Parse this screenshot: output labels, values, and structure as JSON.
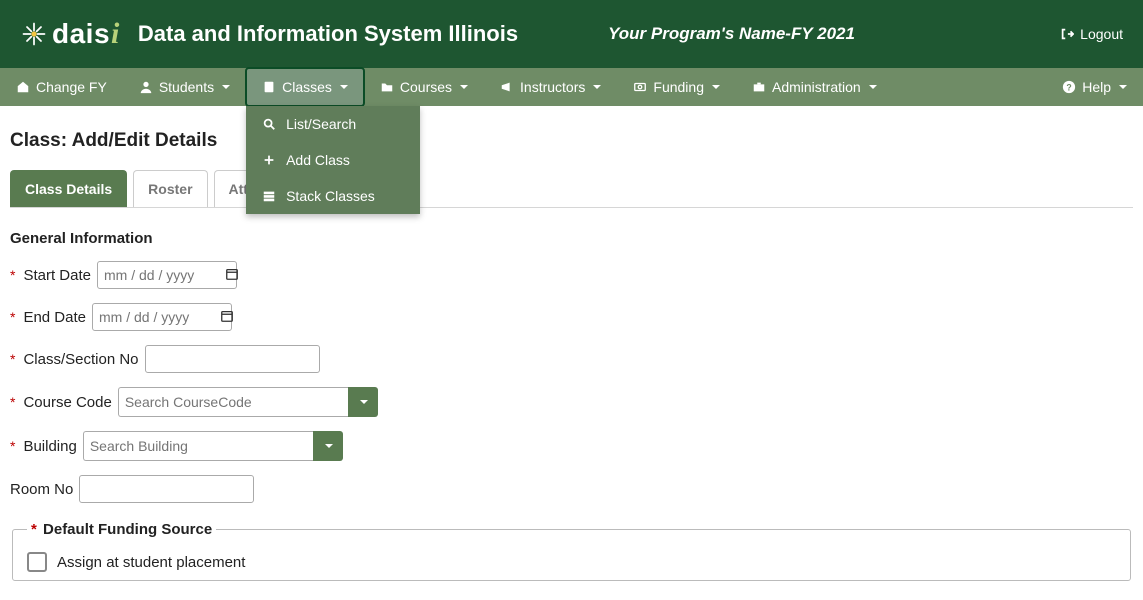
{
  "header": {
    "logo_text_main": "dais",
    "logo_text_accent": "i",
    "app_title": "Data and Information System Illinois",
    "program_name": "Your Program's Name-FY 2021",
    "logout_label": "Logout"
  },
  "nav": {
    "change_fy": "Change FY",
    "students": "Students",
    "classes": "Classes",
    "courses": "Courses",
    "instructors": "Instructors",
    "funding": "Funding",
    "administration": "Administration",
    "help": "Help"
  },
  "classes_menu": {
    "list_search": "List/Search",
    "add_class": "Add Class",
    "stack_classes": "Stack Classes"
  },
  "page": {
    "title": "Class: Add/Edit Details"
  },
  "tabs": {
    "details": "Class Details",
    "roster": "Roster",
    "attendance": "Attenda"
  },
  "section": {
    "general_info": "General Information"
  },
  "fields": {
    "start_date_label": "Start Date",
    "start_date_placeholder": "mm / dd / yyyy",
    "end_date_label": "End Date",
    "end_date_placeholder": "mm / dd / yyyy",
    "class_section_label": "Class/Section No",
    "course_code_label": "Course Code",
    "course_code_placeholder": "Search CourseCode",
    "building_label": "Building",
    "building_placeholder": "Search Building",
    "room_no_label": "Room No"
  },
  "funding": {
    "legend_prefix": "* ",
    "legend": "Default Funding Source",
    "assign_label": "Assign at student placement"
  }
}
